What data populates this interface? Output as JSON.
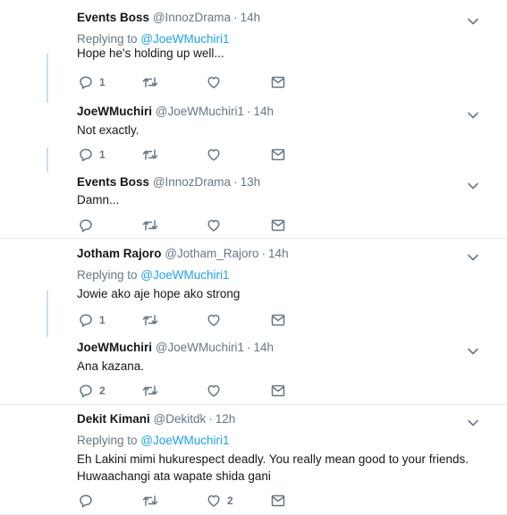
{
  "reply_prefix": "Replying to ",
  "threads": [
    {
      "tweets": [
        {
          "name": "Events Boss",
          "handle": "@InnozDrama",
          "time": "14h",
          "reply_to": "@JoeWMuchiri1",
          "text": "Hope he's holding up well...",
          "replies": "1",
          "likes": ""
        },
        {
          "name": "JoeWMuchiri",
          "handle": "@JoeWMuchiri1",
          "time": "14h",
          "reply_to": "",
          "text": "Not exactly.",
          "replies": "1",
          "likes": ""
        },
        {
          "name": "Events Boss",
          "handle": "@InnozDrama",
          "time": "13h",
          "reply_to": "",
          "text": "Damn...",
          "replies": "",
          "likes": ""
        }
      ]
    },
    {
      "tweets": [
        {
          "name": "Jotham Rajoro",
          "handle": "@Jotham_Rajoro",
          "time": "14h",
          "reply_to": "@JoeWMuchiri1",
          "text": "Jowie ako aje hope ako strong",
          "replies": "1",
          "likes": ""
        },
        {
          "name": "JoeWMuchiri",
          "handle": "@JoeWMuchiri1",
          "time": "14h",
          "reply_to": "",
          "text": "Ana kazana.",
          "replies": "2",
          "likes": ""
        }
      ]
    },
    {
      "tweets": [
        {
          "name": "Dekit Kimani",
          "handle": "@Dekitdk",
          "time": "12h",
          "reply_to": "@JoeWMuchiri1",
          "text": "Eh Lakini mimi hukurespect deadly. You really mean good to your friends. Huwaachangi ata wapate shida gani",
          "replies": "",
          "likes": "2"
        }
      ]
    }
  ],
  "icons": {
    "reply": "reply-icon",
    "retweet": "retweet-icon",
    "like": "heart-icon",
    "dm": "envelope-icon",
    "more": "chevron-down-icon"
  },
  "colors": {
    "link": "#1da1f2",
    "muted": "#657786",
    "connector": "#c7dff0"
  }
}
